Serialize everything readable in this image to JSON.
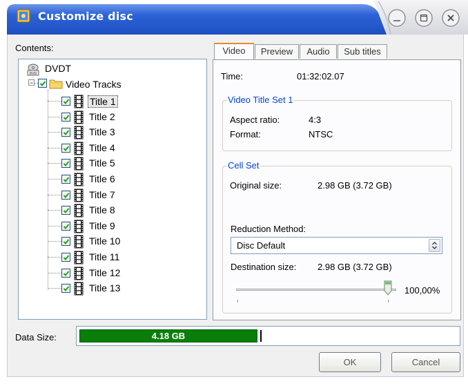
{
  "window": {
    "title": "Customize disc",
    "buttons": [
      "minimize",
      "restore",
      "close"
    ]
  },
  "contents": {
    "label": "Contents:",
    "root": "DVDT",
    "root_icon": "dvd-drive-icon",
    "folder": "Video Tracks",
    "titles": [
      "Title 1",
      "Title 2",
      "Title 3",
      "Title 4",
      "Title 5",
      "Title 6",
      "Title 7",
      "Title 8",
      "Title 9",
      "Title 10",
      "Title 11",
      "Title 12",
      "Title 13"
    ],
    "selected_index": 0
  },
  "tabs": [
    "Video",
    "Preview",
    "Audio",
    "Sub titles"
  ],
  "video": {
    "time_label": "Time:",
    "time_value": "01:32:02.07",
    "vts": {
      "title": "Video Title Set 1",
      "aspect_label": "Aspect ratio:",
      "aspect_value": "4:3",
      "format_label": "Format:",
      "format_value": "NTSC"
    },
    "cellset": {
      "title": "Cell Set",
      "original_label": "Original size:",
      "original_value": "2.98 GB (3.72 GB)",
      "reduction_label": "Reduction Method:",
      "reduction_value": "Disc Default",
      "dest_label": "Destination size:",
      "dest_value": "2.98 GB (3.72 GB)",
      "slider_percent": "100,00%",
      "slider_fraction": 0.95
    }
  },
  "datasize": {
    "label": "Data Size:",
    "value": "4.18 GB",
    "fill_fraction": 0.47
  },
  "buttons": {
    "ok": "OK",
    "cancel": "Cancel"
  },
  "colors": {
    "titlebar": "#2a62d6",
    "progress": "#0a7e0a",
    "tab_accent": "#e68b2c",
    "group_title": "#0046d5"
  }
}
